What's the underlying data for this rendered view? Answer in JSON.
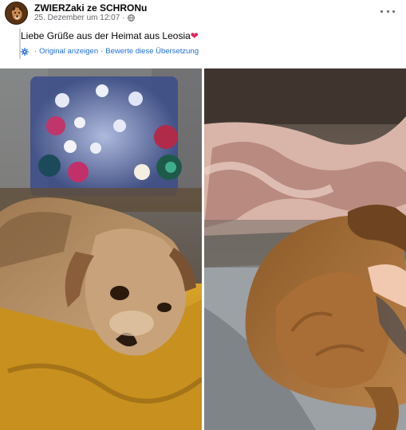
{
  "post": {
    "author": "ZWIERZaki ze SCHRONu",
    "timestamp": "25. Dezember um 12:07",
    "meta_separator": "·",
    "text": "Liebe Grüße aus der Heimat aus Leosia",
    "emoji": "❤",
    "translation": {
      "show_original": "Original anzeigen",
      "separator": "·",
      "rate_translation": "Bewerte diese Übersetzung"
    }
  },
  "icons": {
    "more": "more-options-icon",
    "globe": "globe-icon",
    "translation": "translate-gear-icon"
  },
  "colors": {
    "link": "#216fdb",
    "meta": "#65676b",
    "text": "#050505",
    "heart": "#e0245e"
  },
  "photos": [
    {
      "description_icon": "dog-photo-1"
    },
    {
      "description_icon": "dog-photo-2"
    }
  ]
}
